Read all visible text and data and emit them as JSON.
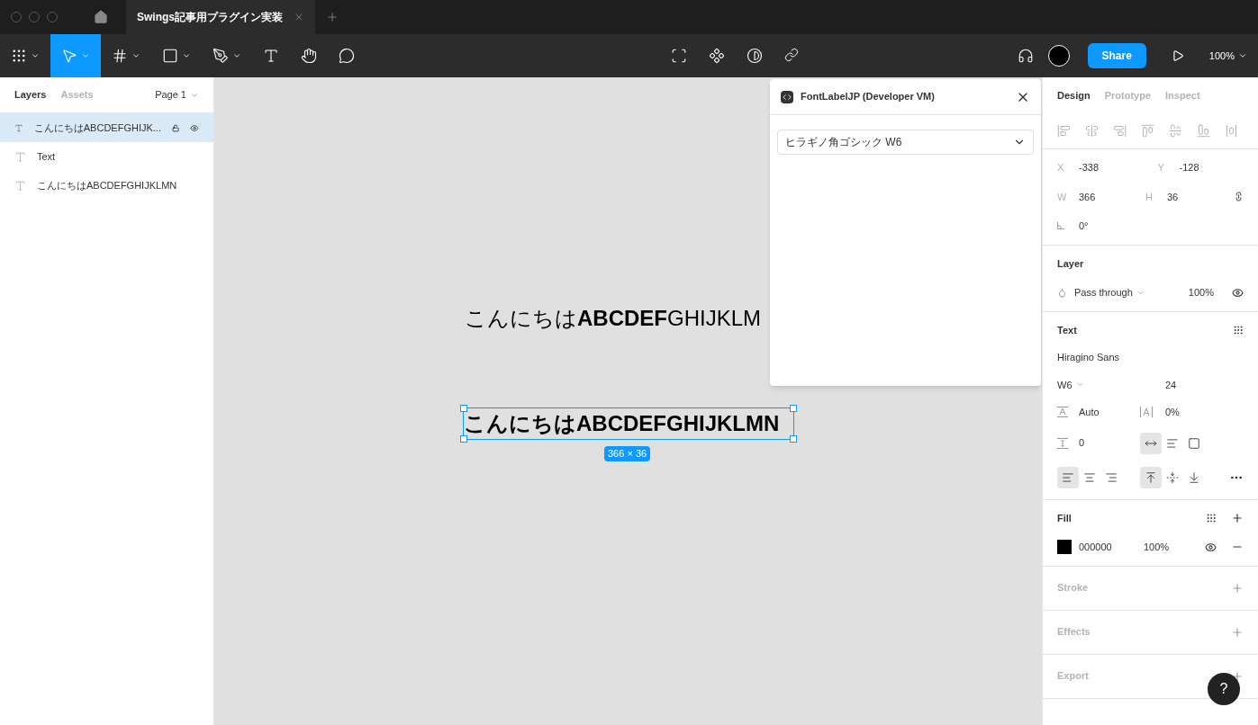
{
  "file_tab": {
    "title": "Swings記事用プラグイン実装",
    "selected": true
  },
  "toolbar": {
    "tools": [
      {
        "kind": "main-menu",
        "selected": false
      },
      {
        "kind": "move",
        "selected": true
      },
      {
        "kind": "frame",
        "selected": false
      },
      {
        "kind": "shape",
        "selected": false
      },
      {
        "kind": "pen",
        "selected": false
      },
      {
        "kind": "text",
        "selected": false
      },
      {
        "kind": "hand",
        "selected": false
      },
      {
        "kind": "comment",
        "selected": false
      }
    ],
    "share": "Share",
    "zoom": "100%"
  },
  "left_panel": {
    "tabs": [
      {
        "label": "Layers",
        "selected": true
      },
      {
        "label": "Assets",
        "selected": false
      }
    ],
    "page": "Page 1",
    "layers": [
      {
        "name": "こんにちはABCDEFGHIJK...",
        "selected": true
      },
      {
        "name": "Text",
        "selected": false
      },
      {
        "name": "こんにちはABCDEFGHIJKLMN",
        "selected": false
      }
    ]
  },
  "canvas": {
    "texts": [
      {
        "text": "こんにちは**ABCDEF**GHIJKLM",
        "selected": false
      },
      {
        "text": "こんにちはABCDEFGHIJKLMN",
        "selected": true
      }
    ],
    "size_label": "366 × 36"
  },
  "plugin": {
    "title": "FontLabelJP (Developer VM)",
    "font_select": "ヒラギノ角ゴシック W6"
  },
  "right_panel": {
    "tabs": [
      {
        "label": "Design",
        "selected": true
      },
      {
        "label": "Prototype",
        "selected": false
      },
      {
        "label": "Inspect",
        "selected": false
      }
    ],
    "x": {
      "label": "X",
      "value": "-338"
    },
    "y": {
      "label": "Y",
      "value": "-128"
    },
    "w": {
      "label": "W",
      "value": "366"
    },
    "h": {
      "label": "H",
      "value": "36"
    },
    "rotation": "0°",
    "layer": {
      "title": "Layer",
      "blend": "Pass through",
      "opacity": "100%"
    },
    "text": {
      "title": "Text",
      "font": "Hiragino Sans",
      "weight": "W6",
      "size": "24",
      "line_height": "Auto",
      "letter_spacing": "0%",
      "paragraph_spacing": "0",
      "resize": [
        {
          "selected": true
        },
        {
          "selected": false
        },
        {
          "selected": false
        }
      ],
      "align": [
        {
          "selected": true
        },
        {
          "selected": false
        },
        {
          "selected": false
        }
      ],
      "valign": [
        {
          "selected": true
        },
        {
          "selected": false
        },
        {
          "selected": false
        }
      ]
    },
    "fill": {
      "title": "Fill",
      "color": "#000000",
      "hex": "000000",
      "opacity": "100%"
    },
    "sections": [
      "Stroke",
      "Effects",
      "Export"
    ]
  },
  "help": "?"
}
